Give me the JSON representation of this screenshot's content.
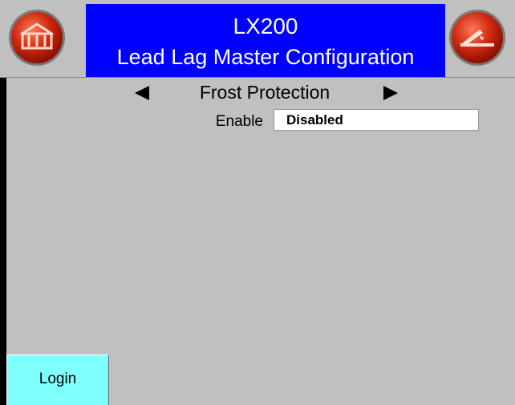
{
  "header": {
    "title": "LX200",
    "subtitle": "Lead Lag Master Configuration",
    "home_icon": "home-icon",
    "back_icon": "back-icon",
    "accent_color": "#0000ff",
    "button_color": "#cc2200"
  },
  "navigator": {
    "label": "Frost Protection",
    "prev_icon": "triangle-left-icon",
    "next_icon": "triangle-right-icon"
  },
  "fields": [
    {
      "label": "Enable",
      "value": "Disabled"
    }
  ],
  "footer": {
    "login_label": "Login",
    "login_color": "#80ffff"
  }
}
